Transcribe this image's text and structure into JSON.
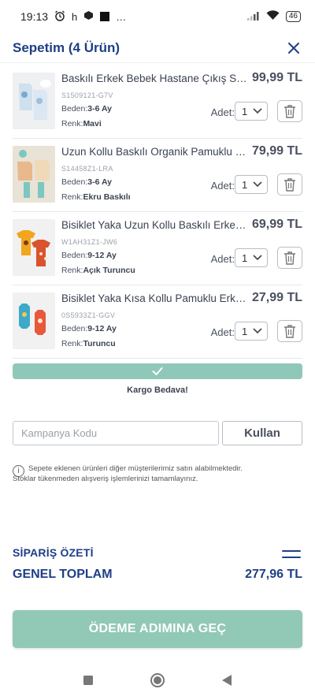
{
  "status_bar": {
    "time": "19:13",
    "extra": "h",
    "more": "…",
    "battery": "46"
  },
  "header": {
    "title": "Sepetim (4 Ürün)"
  },
  "items": [
    {
      "name": "Baskılı Erkek Bebek Hastane Çıkış Seti",
      "price": "99,99 TL",
      "code": "S1509121-G7V",
      "size_label": "Beden:",
      "size": "3-6 Ay",
      "color_label": "Renk:",
      "color": "Mavi",
      "qty_label": "Adet:",
      "qty": "1"
    },
    {
      "name": "Uzun Kollu Baskılı Organik Pamuklu Erkek Bebek",
      "price": "79,99 TL",
      "code": "S14458Z1-LRA",
      "size_label": "Beden:",
      "size": "3-6 Ay",
      "color_label": "Renk:",
      "color": "Ekru Baskılı",
      "qty_label": "Adet:",
      "qty": "1"
    },
    {
      "name": "Bisiklet Yaka Uzun Kollu Baskılı Erkek Bebek",
      "price": "69,99 TL",
      "code": "W1AH31Z1-JW6",
      "size_label": "Beden:",
      "size": "9-12 Ay",
      "color_label": "Renk:",
      "color": "Açık Turuncu",
      "qty_label": "Adet:",
      "qty": "1"
    },
    {
      "name": "Bisiklet Yaka Kısa Kollu Pamuklu Erkek Bebek",
      "price": "27,99 TL",
      "code": "0S5933Z1-GGV",
      "size_label": "Beden:",
      "size": "9-12 Ay",
      "color_label": "Renk:",
      "color": "Turuncu",
      "qty_label": "Adet:",
      "qty": "1"
    }
  ],
  "cargo": {
    "text": "Kargo Bedava!",
    "progress": 1.0
  },
  "promo": {
    "placeholder": "Kampanya Kodu",
    "button": "Kullan"
  },
  "info": {
    "line1": "Sepete eklenen ürünleri diğer müşterilerimiz satın alabilmektedir.",
    "line2": "Stoklar tükenmeden alışveriş işlemlerinizi tamamlayınız."
  },
  "summary": {
    "title": "SİPARİŞ ÖZETİ",
    "total_label": "GENEL TOPLAM",
    "total_value": "277,96 TL"
  },
  "checkout": {
    "label": "ÖDEME ADIMINA GEÇ"
  },
  "colors": {
    "brand_blue": "#1f3e86",
    "accent_green": "#91c9b6"
  }
}
